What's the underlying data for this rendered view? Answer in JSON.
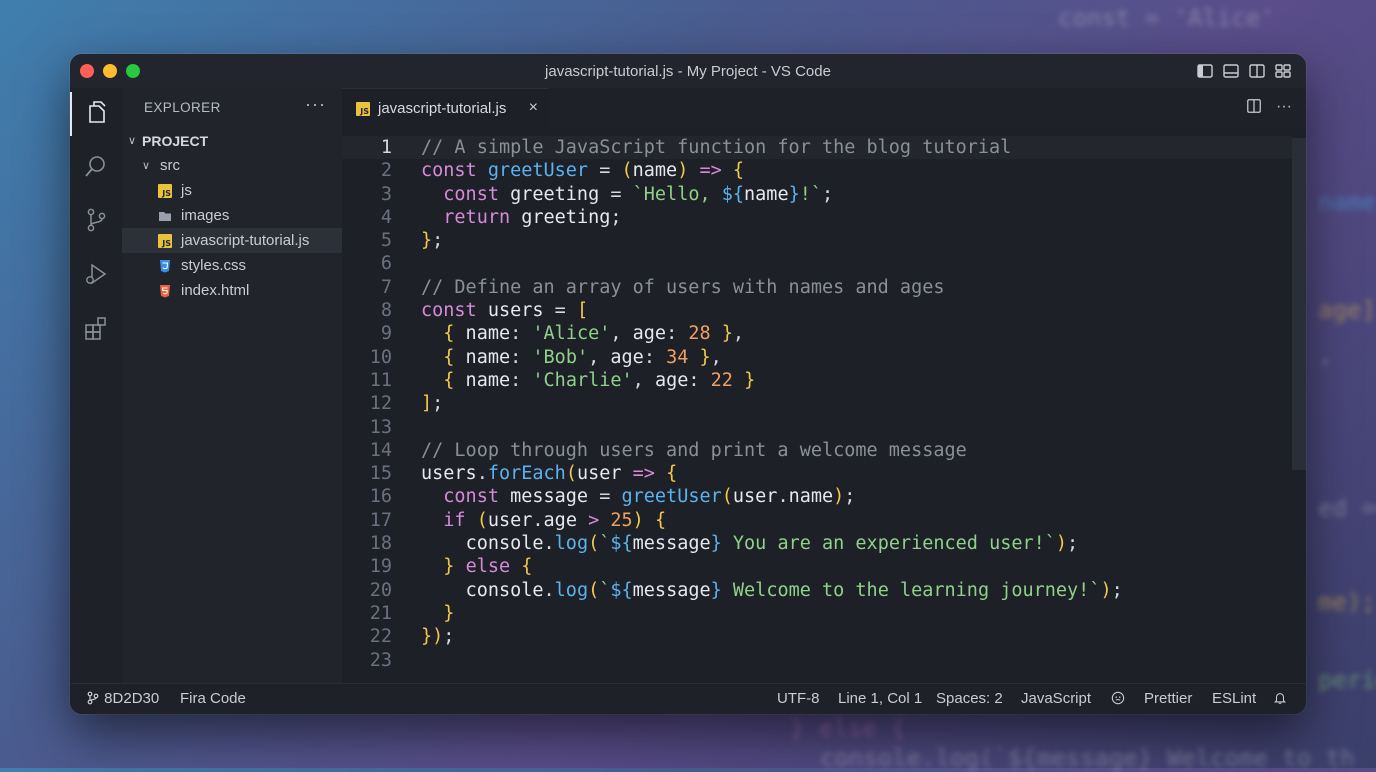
{
  "window": {
    "title": "javascript-tutorial.js - My Project - VS Code"
  },
  "sidebar": {
    "header": "EXPLORER",
    "more": "···",
    "tree": [
      {
        "label": "PROJECT",
        "type": "root-folder",
        "indent": 0
      },
      {
        "label": "src",
        "type": "folder",
        "indent": 1
      },
      {
        "label": "js",
        "type": "js-file",
        "indent": 2
      },
      {
        "label": "images",
        "type": "folder-closed",
        "indent": 2
      },
      {
        "label": "javascript-tutorial.js",
        "type": "js-file",
        "indent": 2,
        "selected": true
      },
      {
        "label": "styles.css",
        "type": "css-file",
        "indent": 2
      },
      {
        "label": "index.html",
        "type": "html-file",
        "indent": 2
      }
    ]
  },
  "activity_bar": {
    "items": [
      "files-icon",
      "search-icon",
      "source-control-icon",
      "run-debug-icon",
      "extensions-icon"
    ]
  },
  "editor": {
    "tab": {
      "label": "javascript-tutorial.js",
      "icon_text": "JS",
      "close": "×"
    },
    "lines": [
      [
        [
          "c",
          "// A simple JavaScript function for the blog tutorial"
        ]
      ],
      [
        [
          "k",
          "const "
        ],
        [
          "f",
          "greetUser"
        ],
        [
          "p",
          " = "
        ],
        [
          "b",
          "("
        ],
        [
          "v",
          "name"
        ],
        [
          "b",
          ")"
        ],
        [
          "p",
          " "
        ],
        [
          "k",
          "=>"
        ],
        [
          "p",
          " "
        ],
        [
          "b",
          "{"
        ]
      ],
      [
        [
          "p",
          "  "
        ],
        [
          "k",
          "const "
        ],
        [
          "v",
          "greeting"
        ],
        [
          "p",
          " = "
        ],
        [
          "s",
          "`Hello, "
        ],
        [
          "f",
          "${"
        ],
        [
          "v",
          "name"
        ],
        [
          "f",
          "}"
        ],
        [
          "s",
          "!`"
        ],
        [
          "p",
          ";"
        ]
      ],
      [
        [
          "p",
          "  "
        ],
        [
          "k",
          "return "
        ],
        [
          "v",
          "greeting"
        ],
        [
          "p",
          ";"
        ]
      ],
      [
        [
          "b",
          "}"
        ],
        [
          "p",
          ";"
        ]
      ],
      [],
      [
        [
          "c",
          "// Define an array of users with names and ages"
        ]
      ],
      [
        [
          "k",
          "const "
        ],
        [
          "v",
          "users"
        ],
        [
          "p",
          " = "
        ],
        [
          "b",
          "["
        ]
      ],
      [
        [
          "p",
          "  "
        ],
        [
          "b",
          "{"
        ],
        [
          "v",
          " name"
        ],
        [
          "p",
          ": "
        ],
        [
          "s",
          "'Alice'"
        ],
        [
          "p",
          ", "
        ],
        [
          "v",
          "age"
        ],
        [
          "p",
          ": "
        ],
        [
          "n",
          "28"
        ],
        [
          "p",
          " "
        ],
        [
          "b",
          "}"
        ],
        [
          "p",
          ","
        ]
      ],
      [
        [
          "p",
          "  "
        ],
        [
          "b",
          "{"
        ],
        [
          "v",
          " name"
        ],
        [
          "p",
          ": "
        ],
        [
          "s",
          "'Bob'"
        ],
        [
          "p",
          ", "
        ],
        [
          "v",
          "age"
        ],
        [
          "p",
          ": "
        ],
        [
          "n",
          "34"
        ],
        [
          "p",
          " "
        ],
        [
          "b",
          "}"
        ],
        [
          "p",
          ","
        ]
      ],
      [
        [
          "p",
          "  "
        ],
        [
          "b",
          "{"
        ],
        [
          "v",
          " name"
        ],
        [
          "p",
          ": "
        ],
        [
          "s",
          "'Charlie'"
        ],
        [
          "p",
          ", "
        ],
        [
          "v",
          "age"
        ],
        [
          "p",
          ": "
        ],
        [
          "n",
          "22"
        ],
        [
          "p",
          " "
        ],
        [
          "b",
          "}"
        ]
      ],
      [
        [
          "b",
          "]"
        ],
        [
          "p",
          ";"
        ]
      ],
      [],
      [
        [
          "c",
          "// Loop through users and print a welcome message"
        ]
      ],
      [
        [
          "v",
          "users"
        ],
        [
          "p",
          "."
        ],
        [
          "f",
          "forEach"
        ],
        [
          "b",
          "("
        ],
        [
          "v",
          "user"
        ],
        [
          "p",
          " "
        ],
        [
          "k",
          "=>"
        ],
        [
          "p",
          " "
        ],
        [
          "b",
          "{"
        ]
      ],
      [
        [
          "p",
          "  "
        ],
        [
          "k",
          "const "
        ],
        [
          "v",
          "message"
        ],
        [
          "p",
          " = "
        ],
        [
          "f",
          "greetUser"
        ],
        [
          "b",
          "("
        ],
        [
          "v",
          "user"
        ],
        [
          "p",
          "."
        ],
        [
          "v",
          "name"
        ],
        [
          "b",
          ")"
        ],
        [
          "p",
          ";"
        ]
      ],
      [
        [
          "p",
          "  "
        ],
        [
          "k",
          "if "
        ],
        [
          "b",
          "("
        ],
        [
          "v",
          "user"
        ],
        [
          "p",
          "."
        ],
        [
          "v",
          "age"
        ],
        [
          "p",
          " "
        ],
        [
          "k",
          ">"
        ],
        [
          "p",
          " "
        ],
        [
          "n",
          "25"
        ],
        [
          "b",
          ")"
        ],
        [
          "p",
          " "
        ],
        [
          "b",
          "{"
        ]
      ],
      [
        [
          "p",
          "    "
        ],
        [
          "v",
          "console"
        ],
        [
          "p",
          "."
        ],
        [
          "f",
          "log"
        ],
        [
          "b",
          "("
        ],
        [
          "s",
          "`"
        ],
        [
          "f",
          "${"
        ],
        [
          "v",
          "message"
        ],
        [
          "f",
          "}"
        ],
        [
          "s",
          " You are an experienced user!`"
        ],
        [
          "b",
          ")"
        ],
        [
          "p",
          ";"
        ]
      ],
      [
        [
          "p",
          "  "
        ],
        [
          "b",
          "}"
        ],
        [
          "p",
          " "
        ],
        [
          "k",
          "else "
        ],
        [
          "b",
          "{"
        ]
      ],
      [
        [
          "p",
          "    "
        ],
        [
          "v",
          "console"
        ],
        [
          "p",
          "."
        ],
        [
          "f",
          "log"
        ],
        [
          "b",
          "("
        ],
        [
          "s",
          "`"
        ],
        [
          "f",
          "${"
        ],
        [
          "v",
          "message"
        ],
        [
          "f",
          "}"
        ],
        [
          "s",
          " Welcome to the learning journey!`"
        ],
        [
          "b",
          ")"
        ],
        [
          "p",
          ";"
        ]
      ],
      [
        [
          "p",
          "  "
        ],
        [
          "b",
          "}"
        ]
      ],
      [
        [
          "b",
          "}"
        ],
        [
          "b",
          ")"
        ],
        [
          "p",
          ";"
        ]
      ],
      []
    ]
  },
  "statusbar": {
    "branch": "8D2D30",
    "font": "Fira Code",
    "encoding": "UTF-8",
    "position": "Line 1, Col 1",
    "spaces": "Spaces: 2",
    "language": "JavaScript",
    "prettier": "Prettier",
    "eslint": "ESLint"
  },
  "background": {
    "ghost_text": [
      "const  =  'Alice'",
      "name",
      "age])",
      ",",
      "ed ==",
      "me);",
      "perien",
      "} else {",
      "console.log(`${message} Welcome to th"
    ]
  },
  "colors": {
    "comment": "#8a8f9a",
    "keyword": "#d68ad9",
    "function": "#5ab3f0",
    "string": "#8fd18a",
    "number": "#f0a060",
    "bracket": "#f2c94c"
  }
}
